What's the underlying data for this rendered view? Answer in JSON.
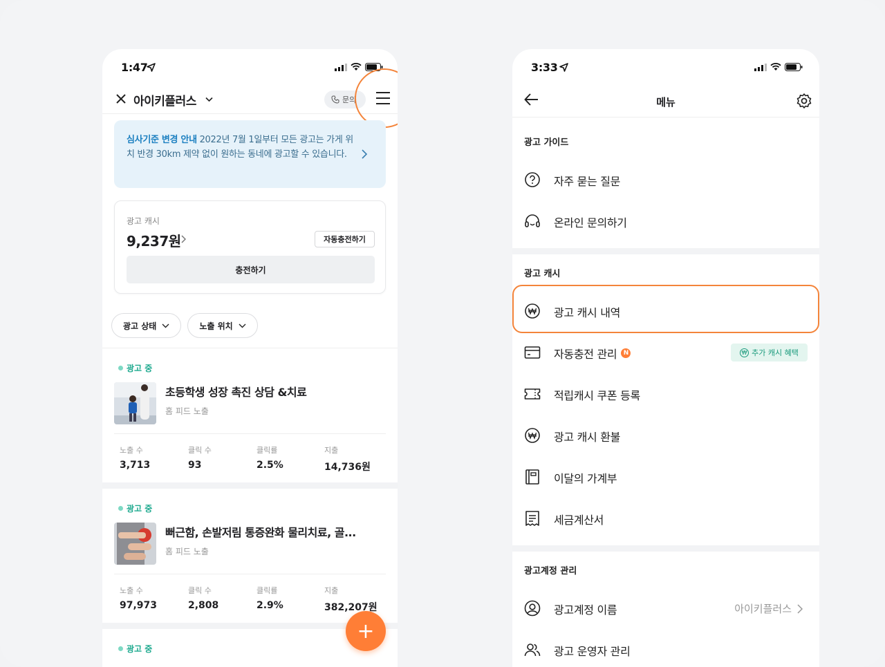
{
  "left_phone": {
    "status_time": "1:47",
    "header": {
      "title": "아이키플러스",
      "inquiry_label": "문의"
    },
    "notice": {
      "bold": "심사기준 변경 안내",
      "text": " 2022년 7월 1일부터 모든 광고는 가게 위치 반경 30km 제약 없이 원하는 동네에 광고할 수 있습니다."
    },
    "cash": {
      "label": "광고 캐시",
      "amount": "9,237원",
      "auto_charge_label": "자동충전하기",
      "charge_label": "충전하기"
    },
    "filters": [
      "광고 상태",
      "노출 위치"
    ],
    "ads": [
      {
        "status": "광고 중",
        "title": "초등학생 성장 촉진 상담 &치료",
        "placement": "홈 피드 노출",
        "stats": [
          {
            "label": "노출 수",
            "value": "3,713"
          },
          {
            "label": "클릭 수",
            "value": "93"
          },
          {
            "label": "클릭률",
            "value": "2.5%"
          },
          {
            "label": "지출",
            "value": "14,736원"
          }
        ]
      },
      {
        "status": "광고 중",
        "title": "뻐근함, 손발저림 통증완화 물리치료, 골...",
        "placement": "홈 피드 노출",
        "stats": [
          {
            "label": "노출 수",
            "value": "97,973"
          },
          {
            "label": "클릭 수",
            "value": "2,808"
          },
          {
            "label": "클릭률",
            "value": "2.9%"
          },
          {
            "label": "지출",
            "value": "382,207원"
          }
        ]
      },
      {
        "status": "광고 중"
      }
    ],
    "fab_label": "+"
  },
  "right_phone": {
    "status_time": "3:33",
    "header": {
      "title": "메뉴"
    },
    "sections": [
      {
        "title": "광고 가이드",
        "items": [
          {
            "label": "자주 묻는 질문",
            "icon": "question-icon"
          },
          {
            "label": "온라인 문의하기",
            "icon": "headset-icon"
          }
        ]
      },
      {
        "title": "광고 캐시",
        "items": [
          {
            "label": "광고 캐시 내역",
            "icon": "won-coin-icon"
          },
          {
            "label": "자동충전 관리",
            "icon": "card-icon",
            "badge": "N",
            "tag": "추가 캐시 혜택"
          },
          {
            "label": "적립캐시 쿠폰 등록",
            "icon": "ticket-icon"
          },
          {
            "label": "광고 캐시 환불",
            "icon": "won-coin-icon"
          },
          {
            "label": "이달의 가계부",
            "icon": "ledger-icon"
          },
          {
            "label": "세금계산서",
            "icon": "receipt-icon"
          }
        ]
      },
      {
        "title": "광고계정 관리",
        "items": [
          {
            "label": "광고계정 이름",
            "icon": "user-circle-icon",
            "value": "아이키플러스"
          },
          {
            "label": "광고 운영자 관리",
            "icon": "users-icon"
          }
        ]
      }
    ]
  },
  "colors": {
    "accent": "#ff7e36",
    "highlight": "#f4843a",
    "active_green": "#1faa8f",
    "notice_bg": "#e6f2fa"
  }
}
